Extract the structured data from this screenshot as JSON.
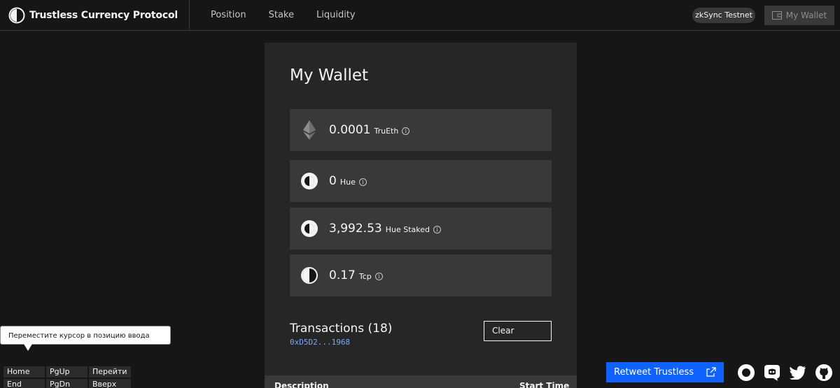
{
  "header": {
    "brand": "Trustless Currency Protocol",
    "nav": [
      "Position",
      "Stake",
      "Liquidity"
    ],
    "network": "zkSync Testnet",
    "wallet_button": "My Wallet"
  },
  "wallet": {
    "title": "My Wallet",
    "assets": [
      {
        "amount": "0.0001",
        "unit": "TruEth",
        "icon": "ethereum-icon"
      },
      {
        "amount": "0",
        "unit": "Hue",
        "icon": "hue-icon"
      },
      {
        "amount": "3,992.53",
        "unit": "Hue Staked",
        "icon": "hue-staked-icon"
      },
      {
        "amount": "0.17",
        "unit": "Tcp",
        "icon": "tcp-icon"
      }
    ],
    "info_glyph": "i"
  },
  "transactions": {
    "title": "Transactions (18)",
    "address": "0xD5D2...1968",
    "clear_label": "Clear",
    "columns": [
      "Description",
      "Start Time"
    ]
  },
  "tooltip": {
    "text": "Переместите курсор в позицию ввода текста."
  },
  "keypad": {
    "keys": [
      "Home",
      "PgUp",
      "Перейти",
      "End",
      "PgDn",
      "Вверх"
    ]
  },
  "footer": {
    "retweet_label": "Retweet Trustless",
    "social_icons": [
      "circle-icon",
      "discord-icon",
      "twitter-icon",
      "github-icon"
    ]
  },
  "colors": {
    "accent": "#0f62fe",
    "address": "#78a9ff",
    "background": "#161616",
    "card": "#262626",
    "tile": "#393939"
  }
}
